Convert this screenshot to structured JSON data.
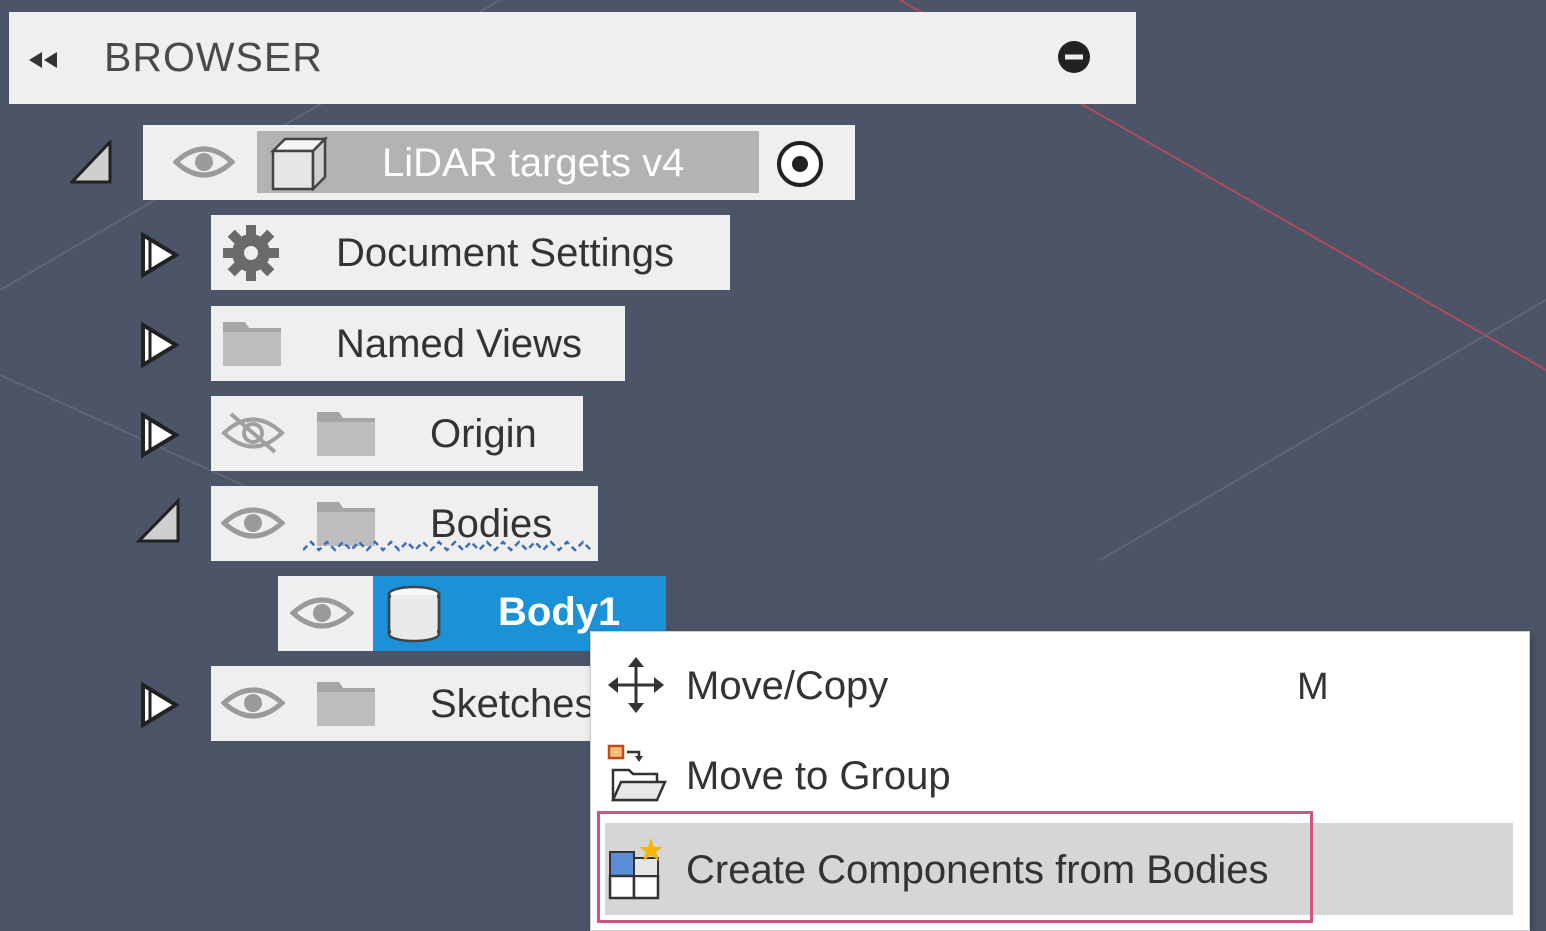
{
  "browser": {
    "title": "BROWSER"
  },
  "tree": {
    "root": {
      "label": "LiDAR targets v4"
    },
    "document_settings": {
      "label": "Document Settings"
    },
    "named_views": {
      "label": "Named Views"
    },
    "origin": {
      "label": "Origin"
    },
    "bodies": {
      "label": "Bodies"
    },
    "body1": {
      "label": "Body1"
    },
    "sketches": {
      "label": "Sketches"
    }
  },
  "context_menu": {
    "items": [
      {
        "label": "Move/Copy",
        "shortcut": "M",
        "icon": "move-arrows-icon"
      },
      {
        "label": "Move to Group",
        "shortcut": "",
        "icon": "move-to-group-icon"
      },
      {
        "label": "Create Components from Bodies",
        "shortcut": "",
        "icon": "create-components-icon"
      }
    ]
  },
  "colors": {
    "viewport_bg": "#4b5567",
    "panel_bg": "#efefef",
    "selection_blue": "#1b92d8",
    "highlight_border": "#d0547c"
  }
}
